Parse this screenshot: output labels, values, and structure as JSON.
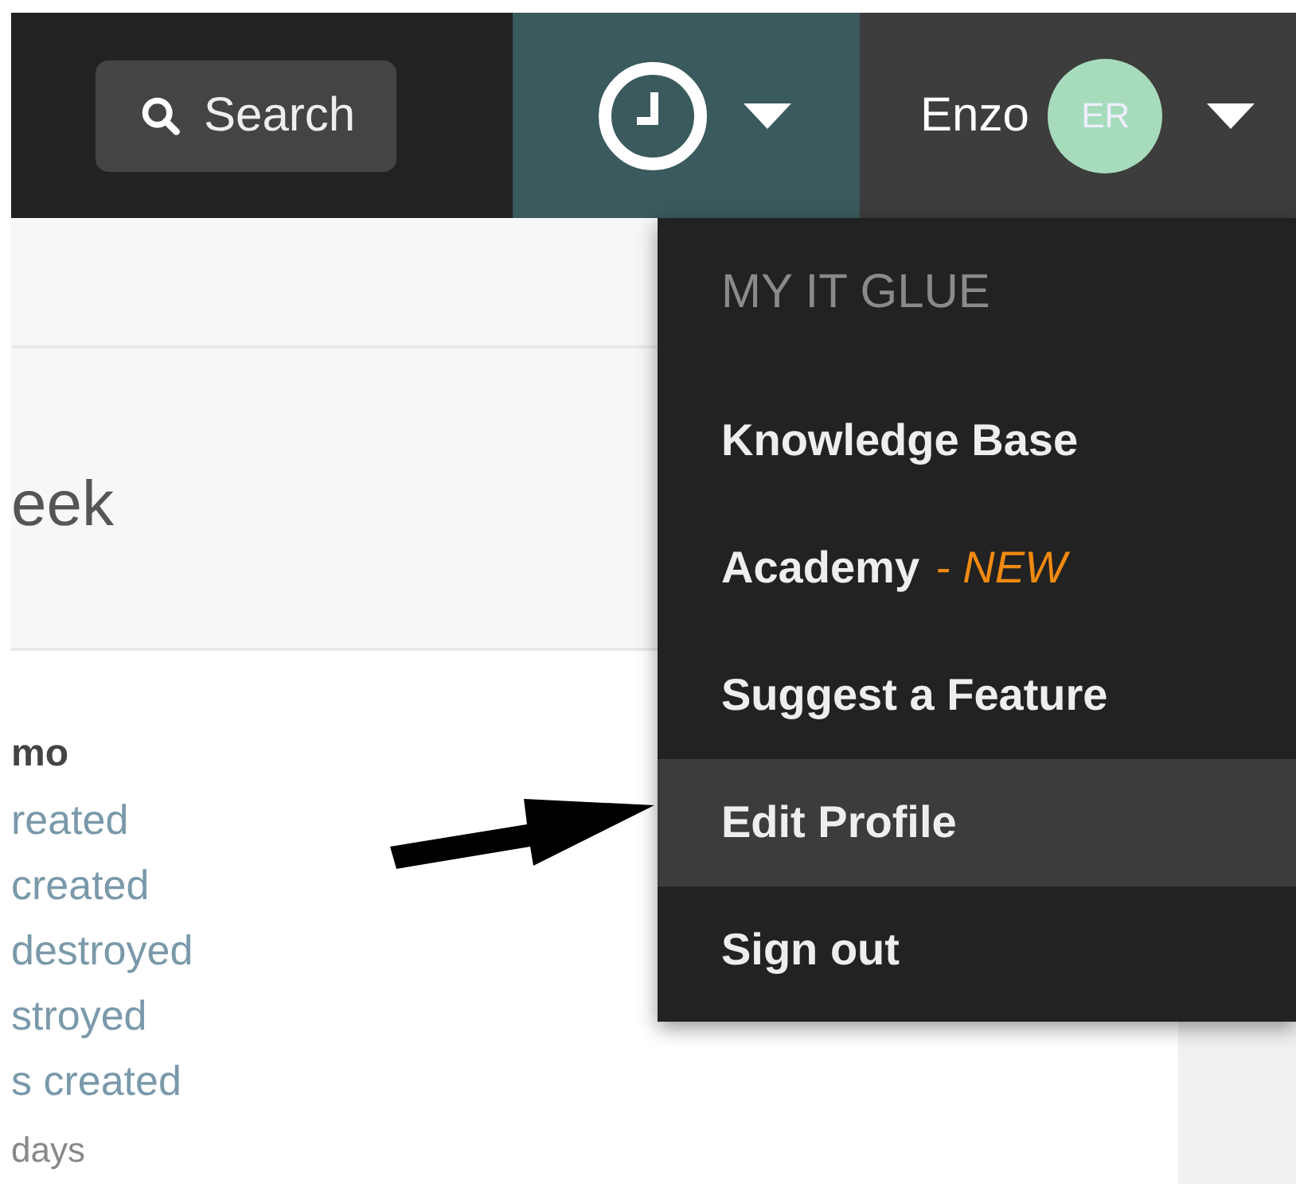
{
  "header": {
    "search": {
      "label": "Search"
    },
    "user": {
      "name": "Enzo",
      "initials": "ER"
    }
  },
  "content": {
    "heading": "eek",
    "group_title": "mo",
    "activity": [
      "reated",
      "created",
      "destroyed",
      "stroyed",
      "s created"
    ],
    "footnote": "days"
  },
  "menu": {
    "items": [
      {
        "kind": "header",
        "label": "MY IT GLUE",
        "selected": false
      },
      {
        "kind": "item",
        "label": "Knowledge Base",
        "selected": false
      },
      {
        "kind": "item",
        "label": "Academy",
        "badge": "- NEW",
        "selected": false
      },
      {
        "kind": "item",
        "label": "Suggest a Feature",
        "selected": false
      },
      {
        "kind": "item",
        "label": "Edit Profile",
        "selected": true
      },
      {
        "kind": "item",
        "label": "Sign out",
        "selected": false
      }
    ]
  }
}
